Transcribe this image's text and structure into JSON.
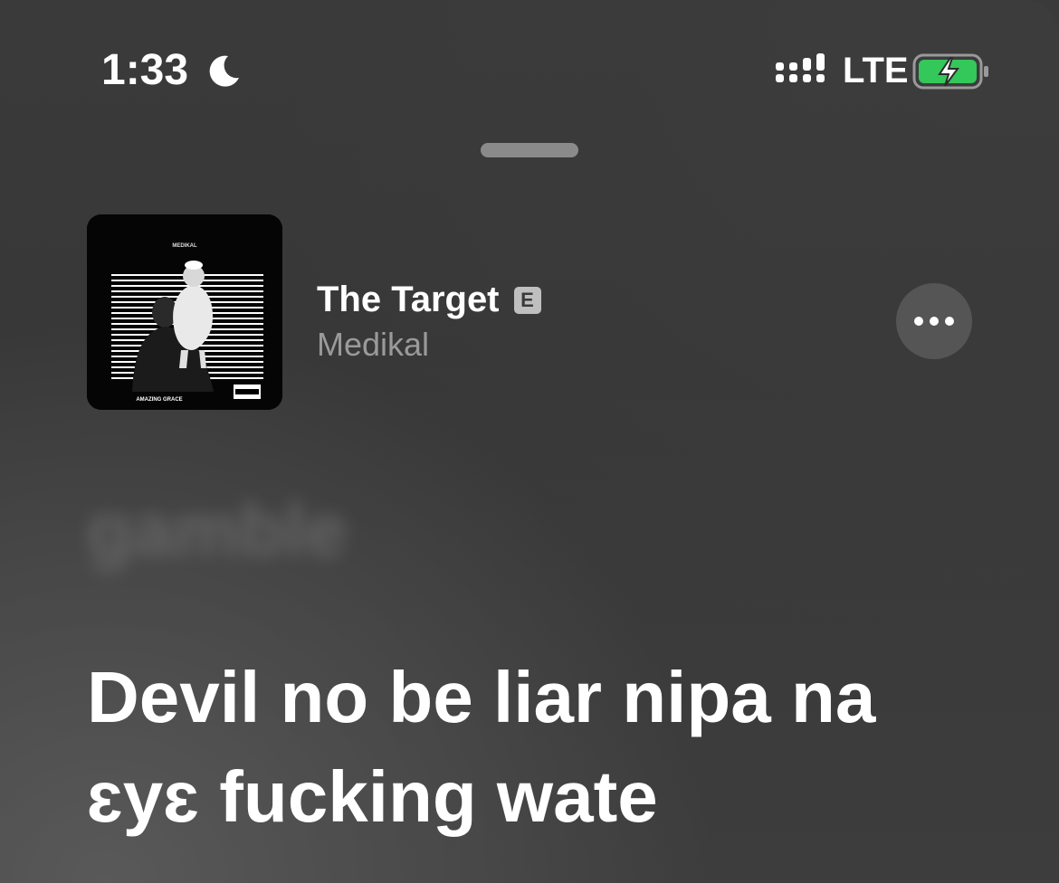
{
  "status_bar": {
    "time": "1:33",
    "network": "LTE",
    "icons": [
      "moon-icon",
      "signal-icon",
      "battery-charging-icon"
    ],
    "battery_color": "#34c759"
  },
  "now_playing": {
    "title": "The Target",
    "explicit_badge": "E",
    "artist": "Medikal",
    "artwork": {
      "artist_text": "MEDIKAL",
      "album_text": "AMAZING GRACE",
      "advisory_text": "PARENTAL ADVISORY EXPLICIT CONTENT"
    }
  },
  "lyrics": {
    "previous_line": "gamble",
    "current_line": "Devil no be liar nipa na ɛyɛ fucking wate"
  }
}
